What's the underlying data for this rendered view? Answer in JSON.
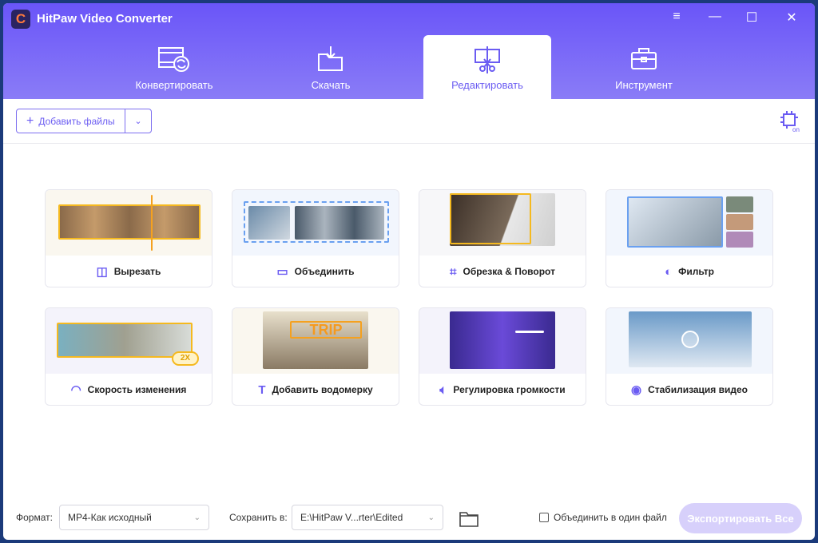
{
  "app": {
    "title": "HitPaw Video Converter",
    "logo": "C"
  },
  "window_controls": {
    "menu": "≡",
    "minimize": "—",
    "maximize": "☐",
    "close": "✕"
  },
  "tabs": [
    {
      "label": "Конвертировать",
      "icon": "film-convert-icon"
    },
    {
      "label": "Скачать",
      "icon": "download-folder-icon"
    },
    {
      "label": "Редактировать",
      "icon": "edit-scissors-icon",
      "active": true
    },
    {
      "label": "Инструмент",
      "icon": "toolbox-icon"
    }
  ],
  "toolbar": {
    "add_files": "Добавить файлы",
    "hw_accel": "hardware-acceleration-on-icon"
  },
  "tools": [
    {
      "label": "Вырезать",
      "icon": "cut-icon"
    },
    {
      "label": "Объединить",
      "icon": "merge-icon"
    },
    {
      "label": "Обрезка & Поворот",
      "icon": "crop-icon"
    },
    {
      "label": "Фильтр",
      "icon": "filter-icon"
    },
    {
      "label": "Скорость изменения",
      "icon": "speed-gauge-icon",
      "badge": "2X"
    },
    {
      "label": "Добавить водомерку",
      "icon": "text-watermark-icon",
      "badge": "TRIP"
    },
    {
      "label": "Регулировка громкости",
      "icon": "volume-icon"
    },
    {
      "label": "Стабилизация видео",
      "icon": "stabilize-icon"
    }
  ],
  "footer": {
    "format_label": "Формат:",
    "format_value": "MP4-Как исходный",
    "save_label": "Сохранить в:",
    "save_value": "E:\\HitPaw V...rter\\Edited",
    "merge_label": "Объединить в один файл",
    "merge_checked": false,
    "export": "Экспортировать Все"
  },
  "colors": {
    "accent": "#6b5cf2",
    "header_top": "#6a55f8",
    "header_bottom": "#8a7cf7",
    "export_disabled": "#d7d0fb"
  }
}
